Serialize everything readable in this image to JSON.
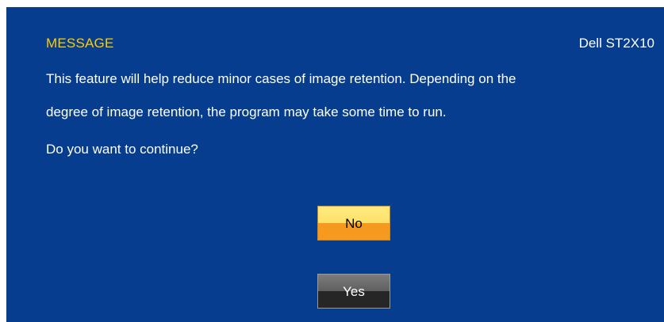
{
  "dialog": {
    "title": "MESSAGE",
    "model": "Dell ST2X10",
    "lines": [
      "This feature will help reduce minor cases of image retention. Depending on the",
      "degree of image retention, the program may take some time to run.",
      "Do you want to continue?"
    ],
    "buttons": {
      "no_label": "No",
      "yes_label": "Yes"
    }
  },
  "colors": {
    "background": "#063d8e",
    "title": "#ffcc00",
    "text": "#ffffff",
    "no_button": "#f59a1e",
    "yes_button": "#262626"
  }
}
